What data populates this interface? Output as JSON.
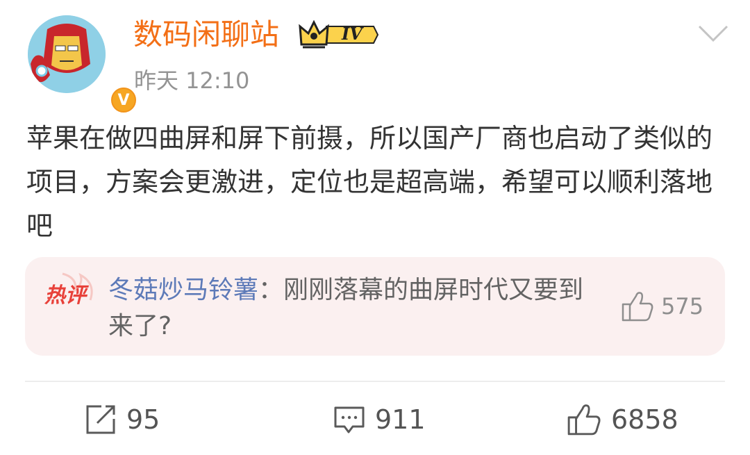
{
  "post": {
    "author": "数码闲聊站",
    "level_badge": "IV",
    "time": "昨天 12:10",
    "verified_mark": "V",
    "content": "苹果在做四曲屏和屏下前摄，所以国产厂商也启动了类似的项目，方案会更激进，定位也是超高端，希望可以顺利落地吧"
  },
  "hot_comment": {
    "tag": "热评",
    "commenter": "冬菇炒马铃薯",
    "separator": "：",
    "text": "刚刚落幕的曲屏时代又要到来了?",
    "likes": "575"
  },
  "actions": {
    "reposts": "95",
    "comments": "911",
    "likes": "6858"
  },
  "colors": {
    "author": "#f36f16",
    "commenter": "#5d7ab8",
    "hot_tag": "#e8413a",
    "card_bg": "#fbf0f0",
    "verified": "#f6a623"
  },
  "icons": [
    "iron-man-avatar",
    "verified-icon",
    "crown-badge-icon",
    "chevron-down-icon",
    "hot-comment-icon",
    "thumbs-up-icon",
    "repost-icon",
    "comment-icon"
  ]
}
